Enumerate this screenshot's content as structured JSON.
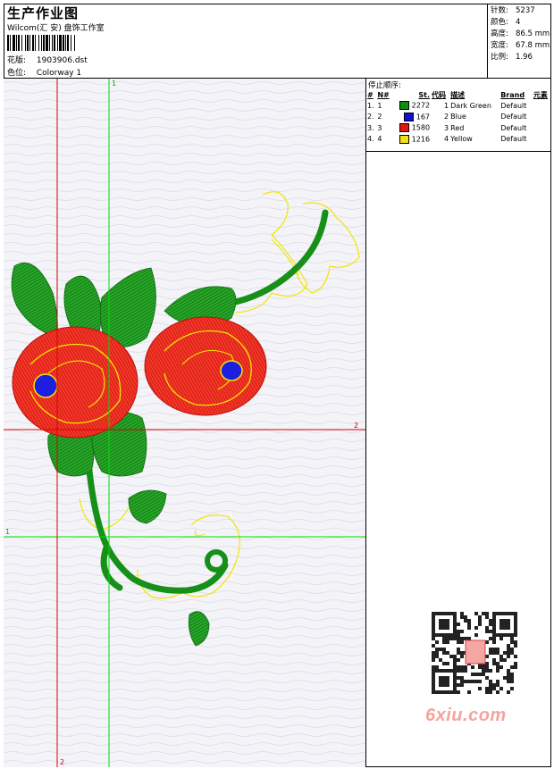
{
  "header": {
    "title": "生产作业图",
    "studio": "Wilcom(汇 安) 盘饰工作室",
    "design_label": "花版:",
    "design_value": "1903906.dst",
    "colorway_label": "色位:",
    "colorway_value": "Colorway 1"
  },
  "specs": [
    {
      "label": "针数:",
      "value": "5237"
    },
    {
      "label": "颜色:",
      "value": "4"
    },
    {
      "label": "高度:",
      "value": "86.5 mm"
    },
    {
      "label": "宽度:",
      "value": "67.8 mm"
    },
    {
      "label": "比例:",
      "value": "1.96"
    }
  ],
  "stop_sequence": {
    "title": "停止顺序:",
    "headers": [
      "#",
      "N#",
      "St.",
      "代码",
      "描述",
      "Brand",
      "元素"
    ],
    "rows": [
      {
        "idx": "1.",
        "n": "1",
        "color": "#118a11",
        "stitches": "2272",
        "code": "1",
        "desc": "Dark Green",
        "brand": "Default"
      },
      {
        "idx": "2.",
        "n": "2",
        "color": "#1010d8",
        "stitches": "167",
        "code": "2",
        "desc": "Blue",
        "brand": "Default"
      },
      {
        "idx": "3.",
        "n": "3",
        "color": "#e01810",
        "stitches": "1580",
        "code": "3",
        "desc": "Red",
        "brand": "Default"
      },
      {
        "idx": "4.",
        "n": "4",
        "color": "#f0e010",
        "stitches": "1216",
        "code": "4",
        "desc": "Yellow",
        "brand": "Default"
      }
    ]
  },
  "guides": {
    "green_v_label": "1",
    "green_h_label": "1",
    "red_v_label": "2",
    "red_h_label": "2"
  },
  "watermark": "6xiu.com",
  "colors": {
    "green": "#1a9a1a",
    "red": "#e5231a",
    "blue": "#1e1ee0",
    "yellow": "#f2e600",
    "guide_green": "#00dd00",
    "guide_red": "#dd0000",
    "watermark": "#f6a39f"
  }
}
